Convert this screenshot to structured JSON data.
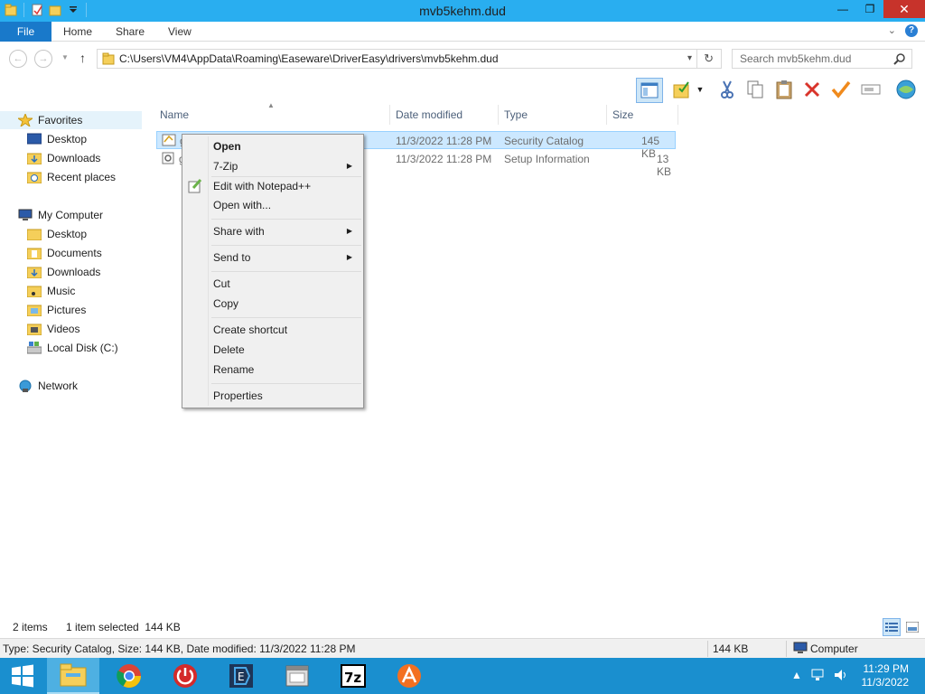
{
  "window": {
    "title": "mvb5kehm.dud",
    "controls": {
      "minimize": "—",
      "maximize": "❐",
      "close": "✕"
    }
  },
  "ribbon": {
    "tabs": [
      {
        "label": "File"
      },
      {
        "label": "Home"
      },
      {
        "label": "Share"
      },
      {
        "label": "View"
      }
    ],
    "expand": "⌄",
    "help": "?"
  },
  "address": {
    "path": "C:\\Users\\VM4\\AppData\\Roaming\\Easeware\\DriverEasy\\drivers\\mvb5kehm.dud",
    "search_placeholder": "Search mvb5kehm.dud"
  },
  "nav_pane": {
    "favorites": {
      "label": "Favorites",
      "items": [
        {
          "label": "Desktop"
        },
        {
          "label": "Downloads"
        },
        {
          "label": "Recent places"
        }
      ]
    },
    "computer": {
      "label": "My Computer",
      "items": [
        {
          "label": "Desktop"
        },
        {
          "label": "Documents"
        },
        {
          "label": "Downloads"
        },
        {
          "label": "Music"
        },
        {
          "label": "Pictures"
        },
        {
          "label": "Videos"
        },
        {
          "label": "Local Disk (C:)"
        }
      ]
    },
    "network": {
      "label": "Network"
    }
  },
  "columns": {
    "name": "Name",
    "date": "Date modified",
    "type": "Type",
    "size": "Size"
  },
  "files": [
    {
      "name": "g",
      "date": "11/3/2022 11:28 PM",
      "type": "Security Catalog",
      "size": "145 KB",
      "selected": true
    },
    {
      "name": "g",
      "date": "11/3/2022 11:28 PM",
      "type": "Setup Information",
      "size": "13 KB",
      "selected": false
    }
  ],
  "context_menu": {
    "open": "Open",
    "zip": "7-Zip",
    "notepad": "Edit with Notepad++",
    "open_with": "Open with...",
    "share_with": "Share with",
    "send_to": "Send to",
    "cut": "Cut",
    "copy": "Copy",
    "create_shortcut": "Create shortcut",
    "delete": "Delete",
    "rename": "Rename",
    "properties": "Properties"
  },
  "status": {
    "count": "2 items",
    "selected": "1 item selected  144 KB"
  },
  "details": {
    "info": "Type: Security Catalog, Size: 144 KB, Date modified: 11/3/2022 11:28 PM",
    "size": "144 KB",
    "location": "Computer"
  },
  "taskbar": {
    "apps": [
      "file-explorer",
      "chrome",
      "power",
      "drivereasy",
      "notepad-window",
      "7zip",
      "avast"
    ],
    "clock": {
      "time": "11:29 PM",
      "date": "11/3/2022"
    }
  },
  "colors": {
    "titlebar": "#29aef0",
    "file_tab": "#1979ca",
    "selection": "#cce8ff",
    "taskbar": "#1a8fcf"
  }
}
